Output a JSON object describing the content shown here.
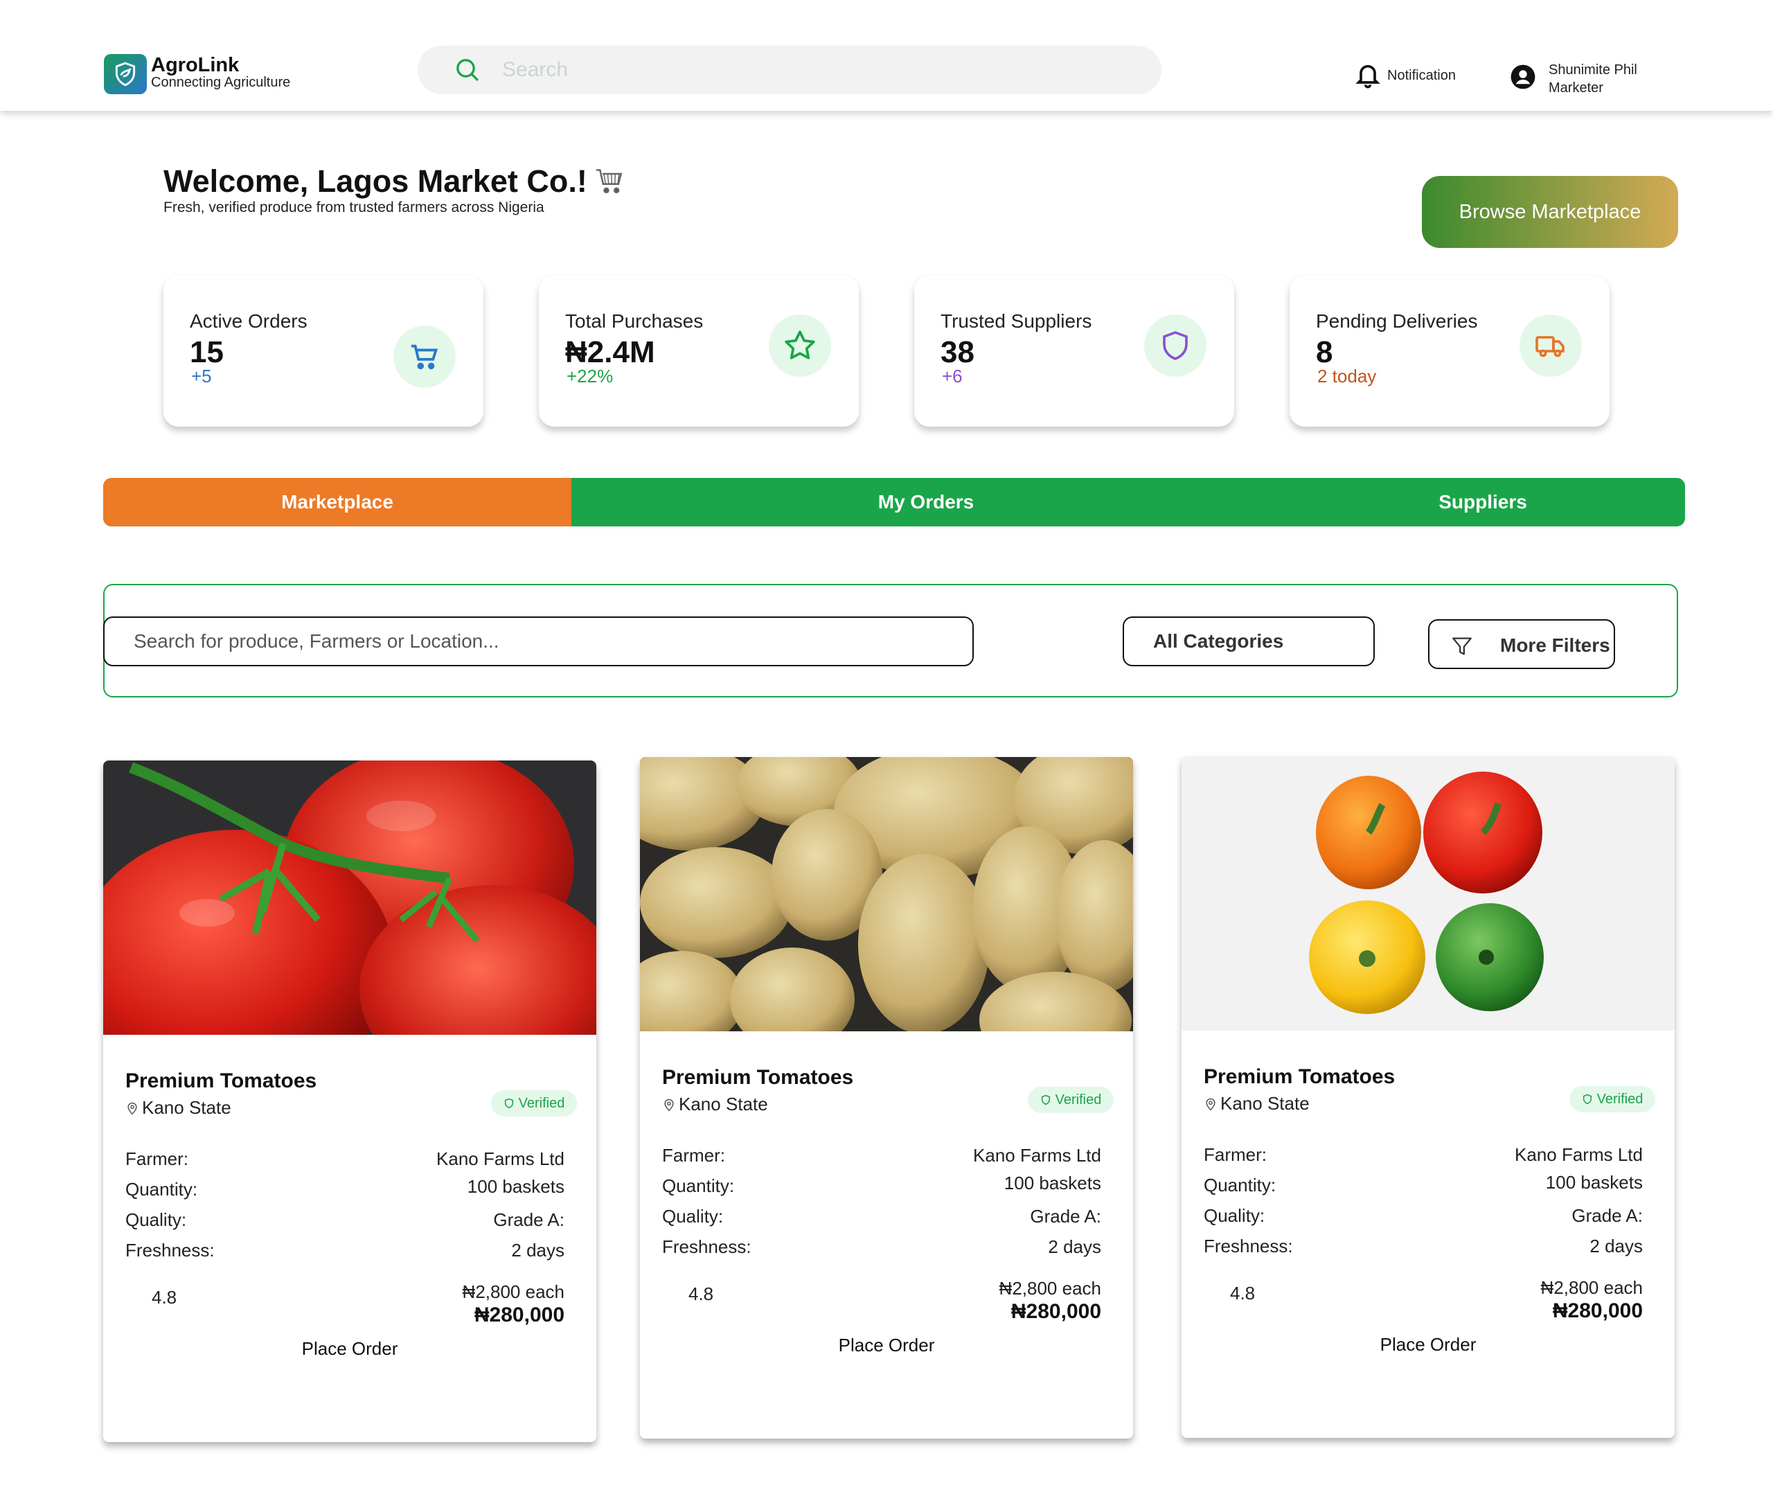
{
  "header": {
    "brand_name": "AgroLink",
    "brand_tagline": "Connecting Agriculture",
    "search_placeholder": "Search",
    "notification_label": "Notification",
    "user_name": "Shunimite Phil",
    "user_role": "Marketer"
  },
  "welcome": {
    "title": "Welcome, Lagos Market Co.!",
    "subtitle": "Fresh, verified produce from trusted farmers across Nigeria",
    "browse_button": "Browse Marketplace"
  },
  "stats": [
    {
      "label": "Active Orders",
      "value": "15",
      "delta": "+5",
      "delta_color": "#2a78c9",
      "icon": "cart-icon"
    },
    {
      "label": "Total Purchases",
      "value": "₦2.4M",
      "delta": "+22%",
      "delta_color": "#1aa549",
      "icon": "star-icon"
    },
    {
      "label": "Trusted Suppliers",
      "value": "38",
      "delta": "+6",
      "delta_color": "#8a4fcf",
      "icon": "shield-icon"
    },
    {
      "label": "Pending Deliveries",
      "value": "8",
      "delta": "2 today",
      "delta_color": "#c2521a",
      "icon": "truck-icon"
    }
  ],
  "tabs": [
    {
      "label": "Marketplace",
      "active": true
    },
    {
      "label": "My Orders",
      "active": false
    },
    {
      "label": "Suppliers",
      "active": false
    }
  ],
  "filters": {
    "search_placeholder": "Search for produce, Farmers or Location...",
    "category_selected": "All Categories",
    "more_filters": "More Filters"
  },
  "products": [
    {
      "name": "Premium Tomatoes",
      "location": "Kano State",
      "badge": "Verified",
      "farmer_label": "Farmer:",
      "farmer": "Kano Farms Ltd",
      "quantity_label": "Quantity:",
      "quantity": "100 baskets",
      "quality_label": "Quality:",
      "quality": "Grade A:",
      "freshness_label": "Freshness:",
      "freshness": "2 days",
      "rating": "4.8",
      "price_each": "₦2,800 each",
      "price_total": "₦280,000",
      "order_button": "Place Order",
      "image": "tomatoes"
    },
    {
      "name": "Premium Tomatoes",
      "location": "Kano State",
      "badge": "Verified",
      "farmer_label": "Farmer:",
      "farmer": "Kano Farms Ltd",
      "quantity_label": "Quantity:",
      "quantity": "100 baskets",
      "quality_label": "Quality:",
      "quality": "Grade A:",
      "freshness_label": "Freshness:",
      "freshness": "2 days",
      "rating": "4.8",
      "price_each": "₦2,800 each",
      "price_total": "₦280,000",
      "order_button": "Place Order",
      "image": "potatoes"
    },
    {
      "name": "Premium Tomatoes",
      "location": "Kano State",
      "badge": "Verified",
      "farmer_label": "Farmer:",
      "farmer": "Kano Farms Ltd",
      "quantity_label": "Quantity:",
      "quantity": "100 baskets",
      "quality_label": "Quality:",
      "quality": "Grade A:",
      "freshness_label": "Freshness:",
      "freshness": "2 days",
      "rating": "4.8",
      "price_each": "₦2,800 each",
      "price_total": "₦280,000",
      "order_button": "Place Order",
      "image": "bell-peppers"
    }
  ],
  "colors": {
    "primary_green": "#1aa549",
    "accent_orange": "#ed7a26",
    "icon_circle_bg": "#e4f8ea"
  }
}
